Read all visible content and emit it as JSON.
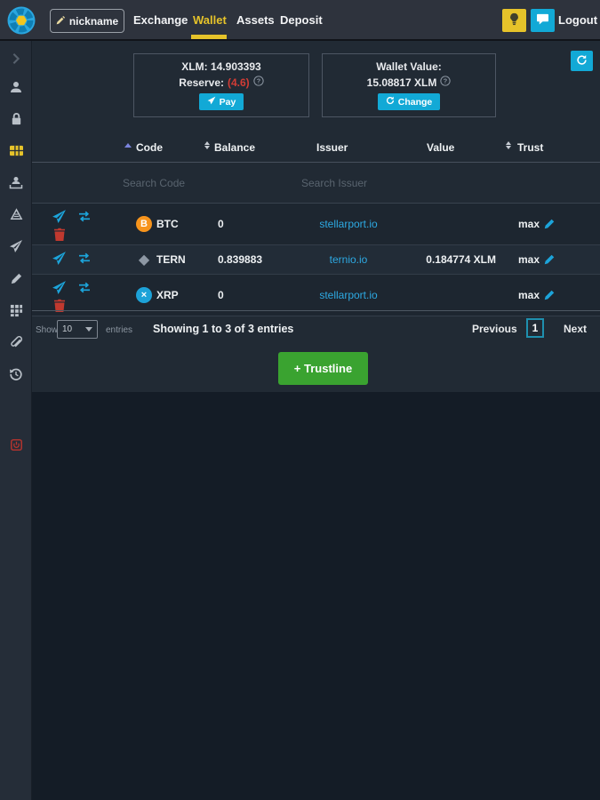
{
  "topbar": {
    "nickname": "nickname",
    "nav": {
      "exchange": "Exchange",
      "wallet": "Wallet",
      "assets": "Assets",
      "deposit": "Deposit"
    },
    "logout": "Logout"
  },
  "summary": {
    "xlm": "XLM: 14.903393",
    "reserve_label": "Reserve:",
    "reserve_value": "(4.6)",
    "pay": "Pay",
    "wallet_value_label": "Wallet Value:",
    "wallet_value": "15.08817 XLM",
    "change": "Change"
  },
  "table": {
    "headers": {
      "code": "Code",
      "balance": "Balance",
      "issuer": "Issuer",
      "value": "Value",
      "trust": "Trust"
    },
    "search_code_placeholder": "Search Code",
    "search_issuer_placeholder": "Search Issuer",
    "rows": [
      {
        "code": "BTC",
        "balance": "0",
        "issuer": "stellarport.io",
        "value": "",
        "trust": "max",
        "deletable": true,
        "icon": {
          "glyph": "B",
          "bg": "#f7941c",
          "fg": "#ffffff",
          "shape": "circle"
        }
      },
      {
        "code": "TERN",
        "balance": "0.839883",
        "issuer": "ternio.io",
        "value": "0.184774 XLM",
        "trust": "max",
        "deletable": false,
        "icon": {
          "glyph": "◆",
          "bg": "transparent",
          "fg": "#8d97a3",
          "shape": "plain"
        }
      },
      {
        "code": "XRP",
        "balance": "0",
        "issuer": "stellarport.io",
        "value": "",
        "trust": "max",
        "deletable": true,
        "icon": {
          "glyph": "×",
          "bg": "#1da2d8",
          "fg": "#ffffff",
          "shape": "circle"
        }
      }
    ]
  },
  "pagination": {
    "show": "Show",
    "page_size": "10",
    "entries": "entries",
    "showing": "Showing 1 to 3 of 3 entries",
    "previous": "Previous",
    "page": "1",
    "next": "Next"
  },
  "actions": {
    "add_trustline": "+ Trustline"
  },
  "colors": {
    "accent_cyan": "#12a9d6",
    "accent_yellow": "#e6c32a",
    "link_cyan": "#2da9e2",
    "danger_red": "#c63b36",
    "success_green": "#3aa330"
  }
}
